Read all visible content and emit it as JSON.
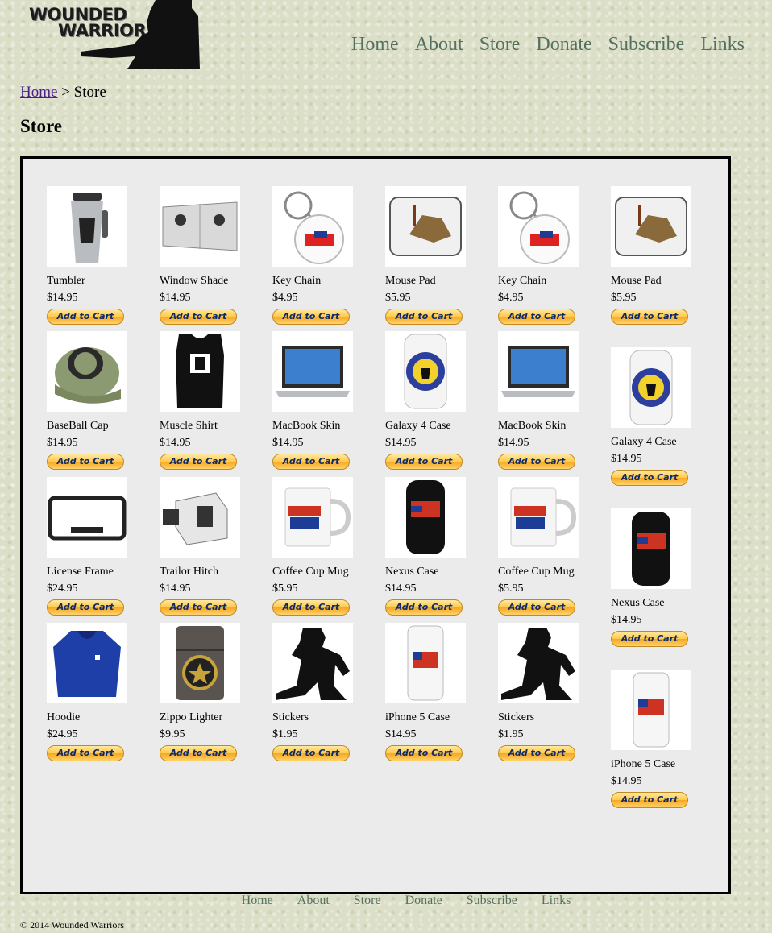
{
  "brand": {
    "line1": "WOUNDED",
    "line2": "WARRIOR"
  },
  "nav": [
    "Home",
    "About",
    "Store",
    "Donate",
    "Subscribe",
    "Links"
  ],
  "breadcrumb": {
    "home": "Home",
    "separator": ">",
    "current": "Store"
  },
  "page_title": "Store",
  "cart_label": "Add to Cart",
  "grid_columns": [
    [
      {
        "name": "Tumbler",
        "price": "$14.95",
        "icon": "tumbler"
      },
      {
        "name": "BaseBall Cap",
        "price": "$14.95",
        "icon": "cap"
      },
      {
        "name": "License Frame",
        "price": "$24.95",
        "icon": "license-frame"
      },
      {
        "name": "Hoodie",
        "price": "$24.95",
        "icon": "hoodie"
      }
    ],
    [
      {
        "name": "Window Shade",
        "price": "$14.95",
        "icon": "window-shade"
      },
      {
        "name": "Muscle Shirt",
        "price": "$14.95",
        "icon": "muscle-shirt"
      },
      {
        "name": "Trailor Hitch",
        "price": "$14.95",
        "icon": "hitch"
      },
      {
        "name": "Zippo Lighter",
        "price": "$9.95",
        "icon": "lighter"
      }
    ],
    [
      {
        "name": "Key Chain",
        "price": "$4.95",
        "icon": "keychain"
      },
      {
        "name": "MacBook Skin",
        "price": "$14.95",
        "icon": "laptop"
      },
      {
        "name": "Coffee Cup Mug",
        "price": "$5.95",
        "icon": "mug"
      },
      {
        "name": "Stickers",
        "price": "$1.95",
        "icon": "soldier"
      }
    ],
    [
      {
        "name": "Mouse Pad",
        "price": "$5.95",
        "icon": "mousepad"
      },
      {
        "name": "Galaxy 4 Case",
        "price": "$14.95",
        "icon": "galaxy-case"
      },
      {
        "name": "Nexus Case",
        "price": "$14.95",
        "icon": "nexus-case"
      },
      {
        "name": "iPhone 5 Case",
        "price": "$14.95",
        "icon": "iphone-case"
      }
    ],
    [
      {
        "name": "Key Chain",
        "price": "$4.95",
        "icon": "keychain"
      },
      {
        "name": "MacBook Skin",
        "price": "$14.95",
        "icon": "laptop"
      },
      {
        "name": "Coffee Cup Mug",
        "price": "$5.95",
        "icon": "mug"
      },
      {
        "name": "Stickers",
        "price": "$1.95",
        "icon": "soldier"
      }
    ],
    [
      {
        "name": "Mouse Pad",
        "price": "$5.95",
        "icon": "mousepad"
      },
      {
        "name": "Galaxy 4 Case",
        "price": "$14.95",
        "icon": "galaxy-case"
      },
      {
        "name": "Nexus Case",
        "price": "$14.95",
        "icon": "nexus-case"
      },
      {
        "name": "iPhone 5 Case",
        "price": "$14.95",
        "icon": "iphone-case"
      }
    ]
  ],
  "footer_nav": [
    "Home",
    "About",
    "Store",
    "Donate",
    "Subscribe",
    "Links"
  ],
  "copyright": "© 2014 Wounded Warriors",
  "colors": {
    "nav": "#56705f",
    "button": "#ffc947",
    "panel": "#ebebeb"
  }
}
